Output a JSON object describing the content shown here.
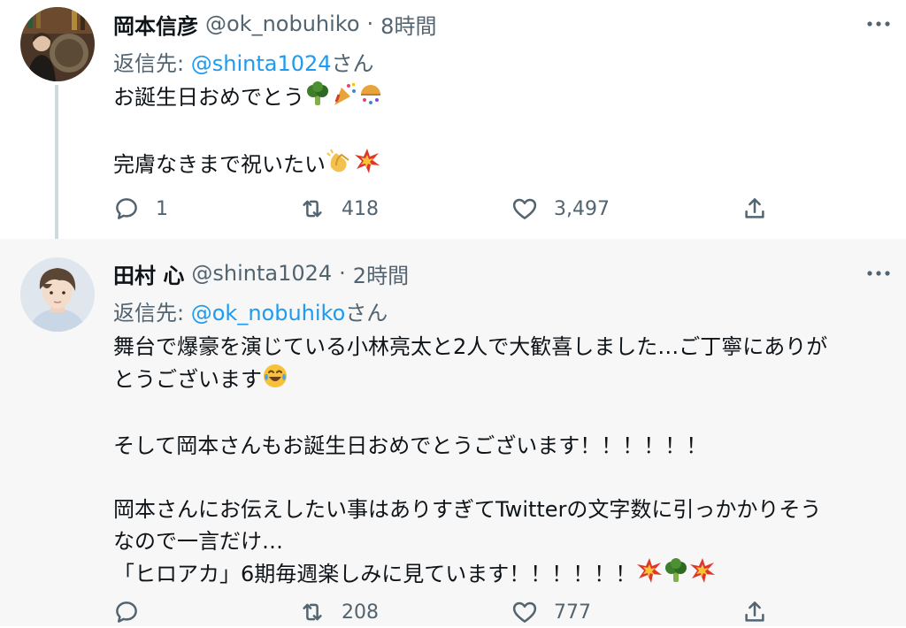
{
  "colors": {
    "text": "#0f1419",
    "muted": "#536471",
    "link": "#1d9bf0",
    "thread_line": "#cfd9de",
    "tweet2_bg": "#f7f7f7"
  },
  "tweets": [
    {
      "display_name": "岡本信彦",
      "handle": "@ok_nobuhiko",
      "separator": "·",
      "time": "8時間",
      "reply_prefix": "返信先:",
      "reply_to": "@shinta1024",
      "reply_suffix": "さん",
      "body_line1": "お誕生日おめでとう",
      "body_line2": "完膚なきまで祝いたい",
      "emojis_line1": [
        "broccoli-emoji",
        "party-popper-emoji",
        "confetti-ball-emoji"
      ],
      "emojis_line2": [
        "clapping-hands-emoji",
        "collision-emoji"
      ],
      "replies": "1",
      "retweets": "418",
      "likes": "3,497"
    },
    {
      "display_name": "田村 心",
      "handle": "@shinta1024",
      "separator": "·",
      "time": "2時間",
      "reply_prefix": "返信先:",
      "reply_to": "@ok_nobuhiko",
      "reply_suffix": "さん",
      "body_p1_line1": "舞台で爆豪を演じている小林亮太と2人で大歓喜しました…ご丁寧にありが",
      "body_p1_line2": "とうございます",
      "body_p2": "そして岡本さんもお誕生日おめでとうございます！！！！！！",
      "body_p3_line1": "岡本さんにお伝えしたい事はありすぎてTwitterの文字数に引っかかりそう",
      "body_p3_line2": "なので一言だけ…",
      "body_p3_line3": "「ヒロアカ」6期毎週楽しみに見ています！！！！！！",
      "emojis_p1": [
        "tears-of-joy-emoji"
      ],
      "emojis_p3": [
        "collision-emoji",
        "broccoli-emoji",
        "collision-emoji"
      ],
      "replies": "",
      "retweets": "208",
      "likes": "777"
    }
  ]
}
